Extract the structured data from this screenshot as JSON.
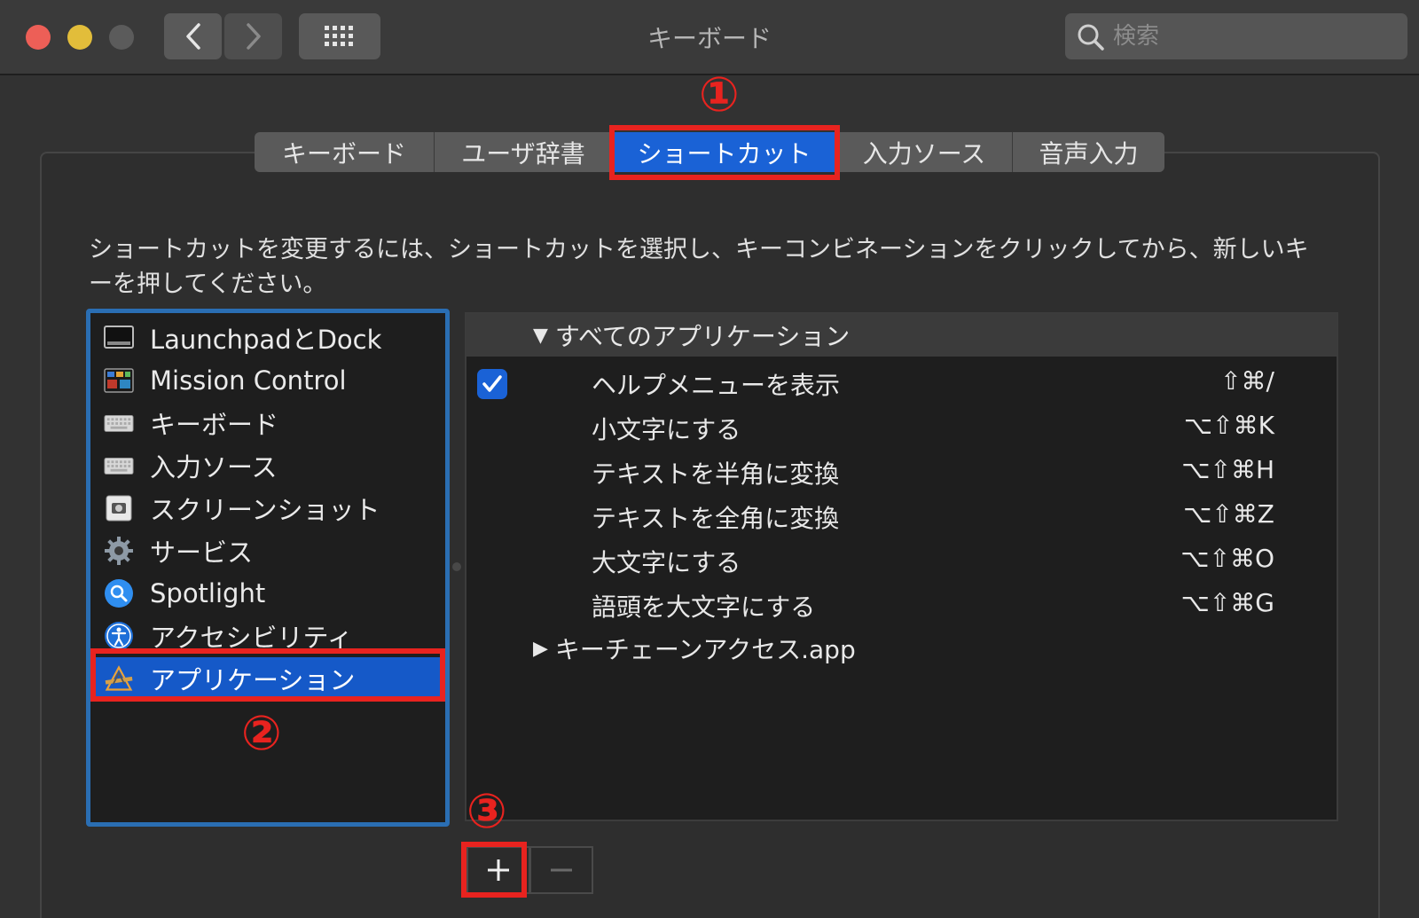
{
  "window": {
    "title": "キーボード",
    "search_placeholder": "検索"
  },
  "tabs": [
    {
      "label": "キーボード"
    },
    {
      "label": "ユーザ辞書"
    },
    {
      "label": "ショートカット",
      "selected": true
    },
    {
      "label": "入力ソース"
    },
    {
      "label": "音声入力"
    }
  ],
  "annotations": {
    "one": "①",
    "two": "②",
    "three": "③",
    "color": "#e8231f"
  },
  "instruction": "ショートカットを変更するには、ショートカットを選択し、キーコンビネーションをクリックしてから、新しいキーを押してください。",
  "categories": [
    {
      "label": "LaunchpadとDock",
      "icon": "launchpad-dock-icon"
    },
    {
      "label": "Mission Control",
      "icon": "mission-control-icon"
    },
    {
      "label": "キーボード",
      "icon": "keyboard-icon"
    },
    {
      "label": "入力ソース",
      "icon": "input-source-icon"
    },
    {
      "label": "スクリーンショット",
      "icon": "screenshot-icon"
    },
    {
      "label": "サービス",
      "icon": "gear-icon"
    },
    {
      "label": "Spotlight",
      "icon": "spotlight-icon"
    },
    {
      "label": "アクセシビリティ",
      "icon": "accessibility-icon"
    },
    {
      "label": "アプリケーション",
      "icon": "app-store-icon",
      "selected": true
    }
  ],
  "shortcuts": {
    "group_all": "すべてのアプリケーション",
    "rows": [
      {
        "label": "ヘルプメニューを表示",
        "keys": "⇧⌘/",
        "checked": true
      },
      {
        "label": "小文字にする",
        "keys": "⌥⇧⌘K"
      },
      {
        "label": "テキストを半角に変換",
        "keys": "⌥⇧⌘H"
      },
      {
        "label": "テキストを全角に変換",
        "keys": "⌥⇧⌘Z"
      },
      {
        "label": "大文字にする",
        "keys": "⌥⇧⌘O"
      },
      {
        "label": "語頭を大文字にする",
        "keys": "⌥⇧⌘G"
      }
    ],
    "group_app": "キーチェーンアクセス.app"
  },
  "buttons": {
    "add": "+",
    "remove": "−"
  },
  "colors": {
    "accent": "#1a62d6",
    "highlight_box": "#e8231f",
    "list_border": "#2a6eb3"
  }
}
